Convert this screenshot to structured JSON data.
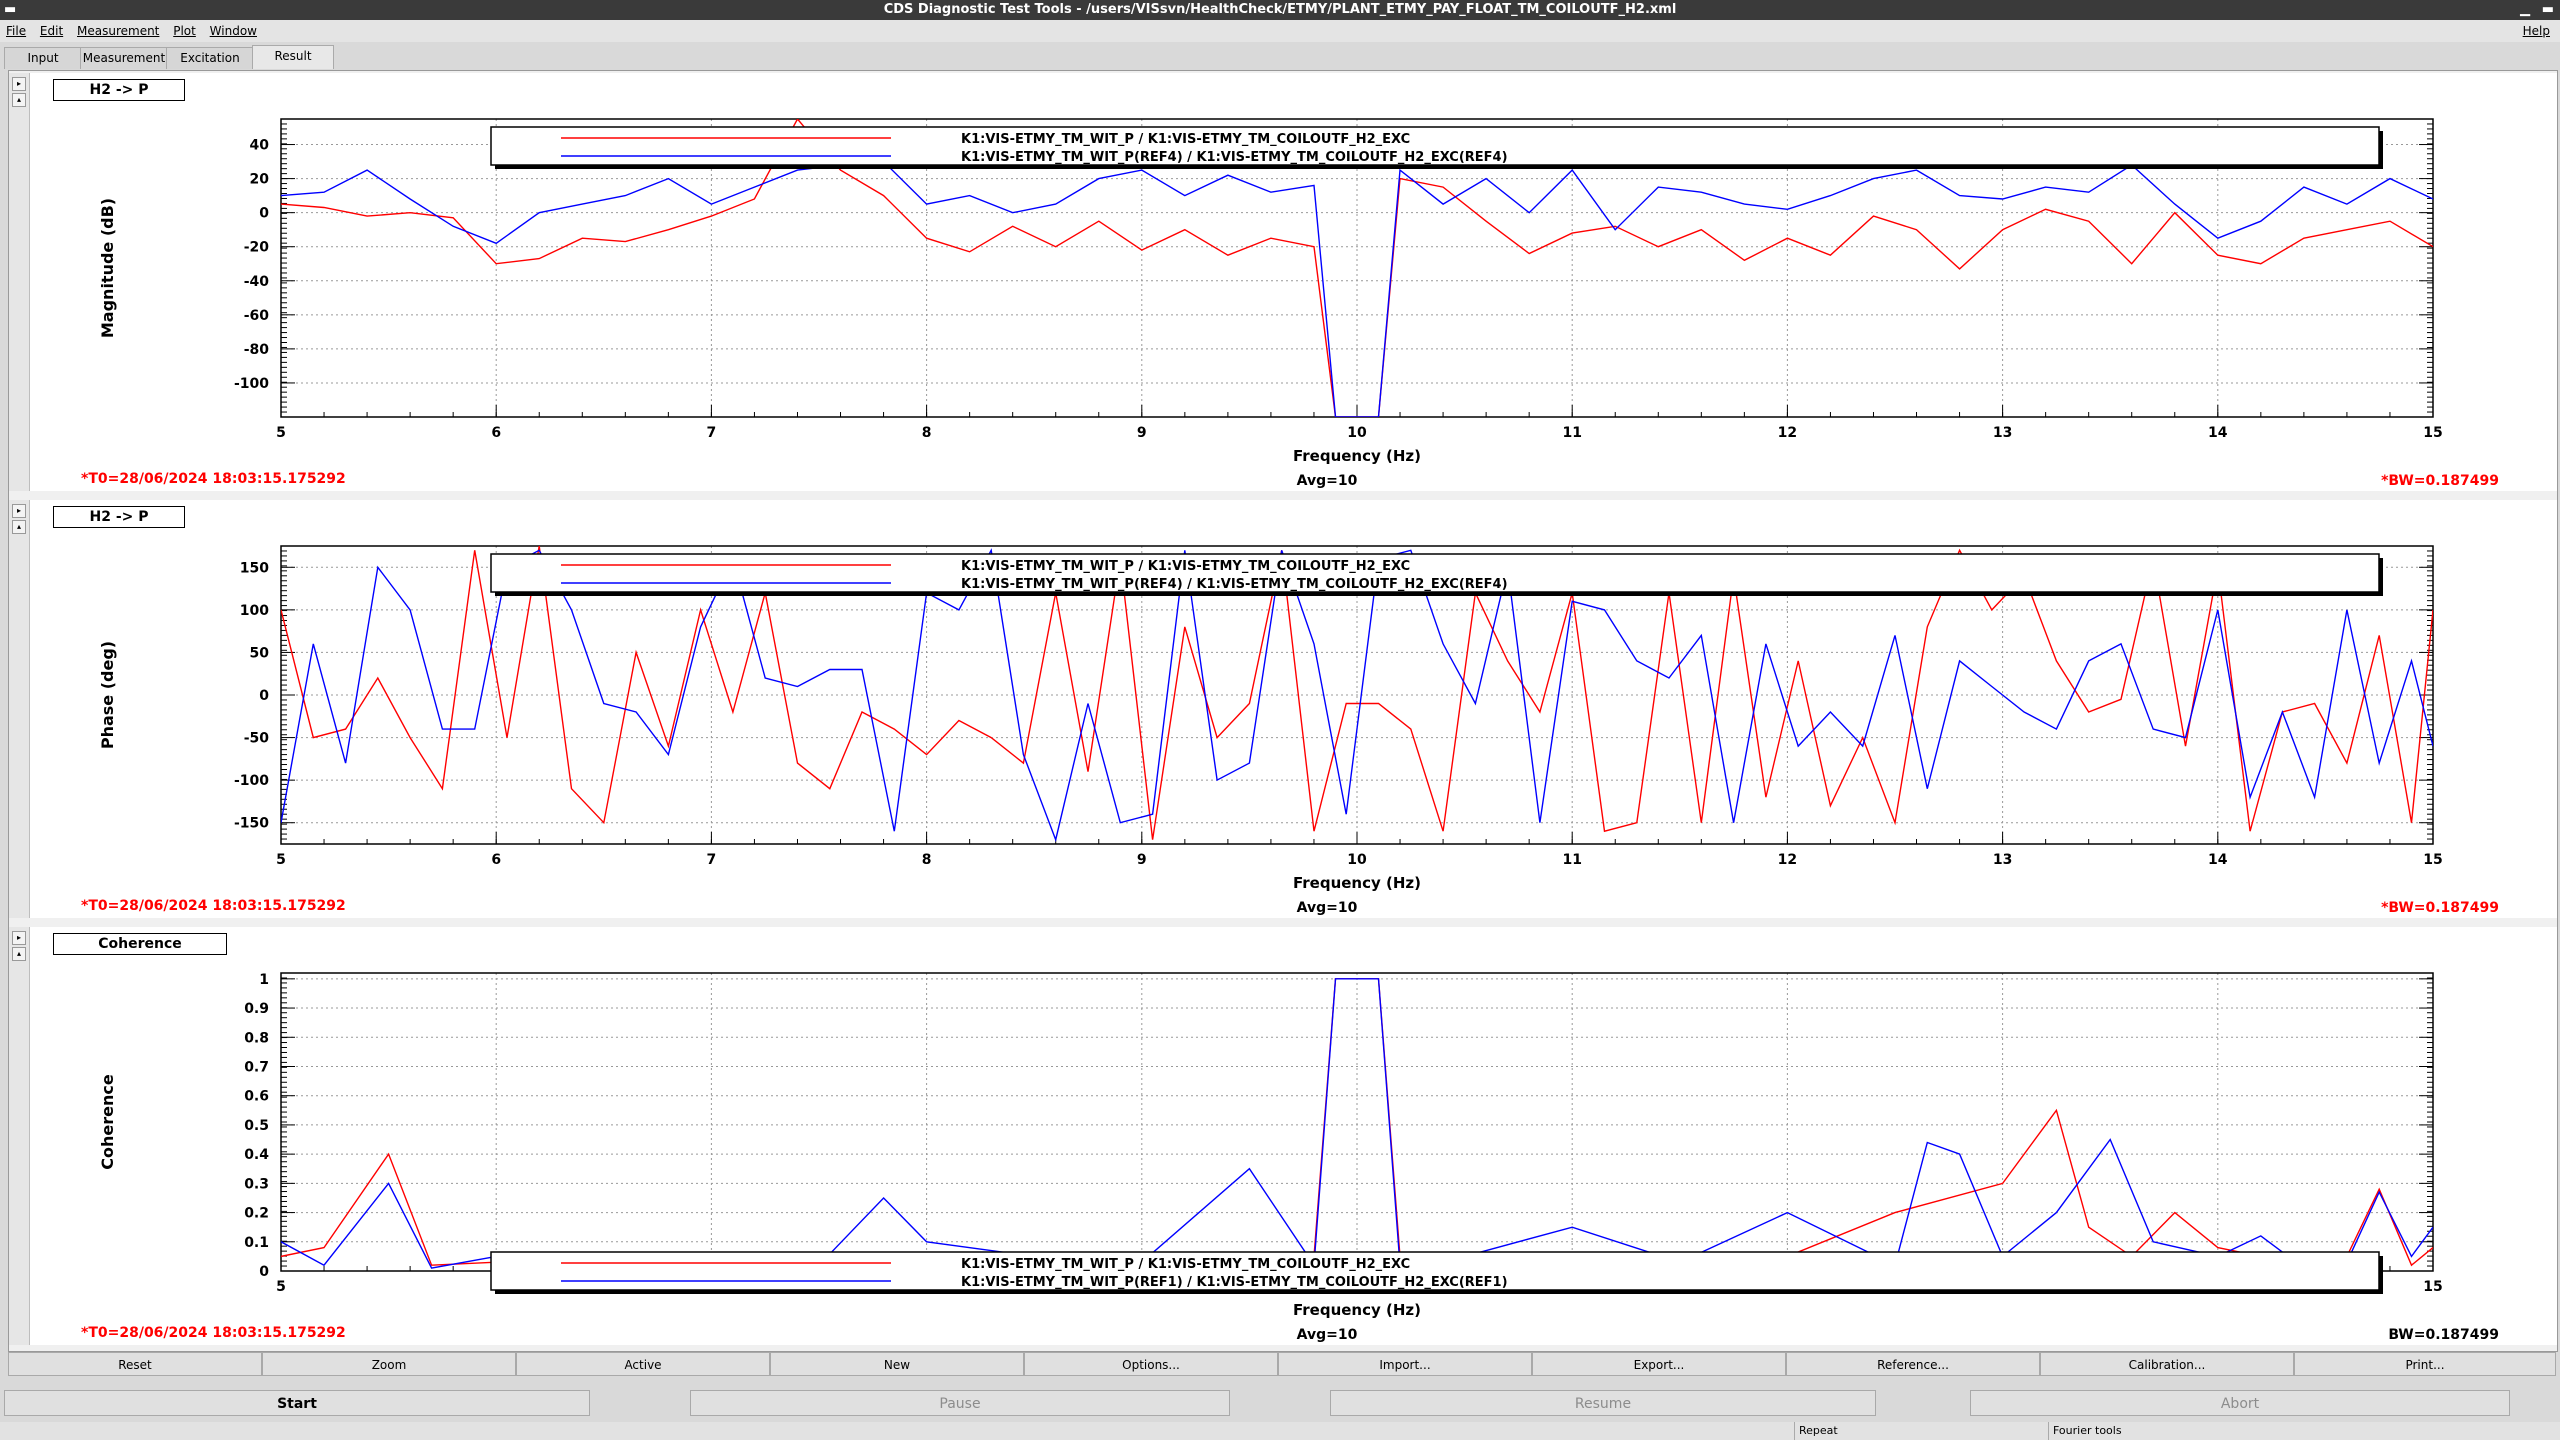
{
  "window": {
    "title": "CDS Diagnostic Test Tools - /users/VISsvn/HealthCheck/ETMY/PLANT_ETMY_PAY_FLOAT_TM_COILOUTF_H2.xml"
  },
  "menu": {
    "items": [
      "File",
      "Edit",
      "Measurement",
      "Plot",
      "Window"
    ],
    "help": "Help"
  },
  "tabs": [
    {
      "label": "Input"
    },
    {
      "label": "Measurement"
    },
    {
      "label": "Excitation"
    },
    {
      "label": "Result"
    }
  ],
  "colors": {
    "trace_a": "#ff0000",
    "trace_b": "#0000ff",
    "info_red": "#ff0000"
  },
  "panels": [
    {
      "title": "H2 -> P",
      "ylabel": "Magnitude (dB)",
      "xlabel": "Frequency (Hz)",
      "t0": "*T0=28/06/2024 18:03:15.175292",
      "avg": "Avg=10",
      "bw": "*BW=0.187499",
      "legend": [
        "K1:VIS-ETMY_TM_WIT_P / K1:VIS-ETMY_TM_COILOUTF_H2_EXC",
        "K1:VIS-ETMY_TM_WIT_P(REF4) / K1:VIS-ETMY_TM_COILOUTF_H2_EXC(REF4)"
      ]
    },
    {
      "title": "H2 -> P",
      "ylabel": "Phase (deg)",
      "xlabel": "Frequency (Hz)",
      "t0": "*T0=28/06/2024 18:03:15.175292",
      "avg": "Avg=10",
      "bw": "*BW=0.187499",
      "legend": [
        "K1:VIS-ETMY_TM_WIT_P / K1:VIS-ETMY_TM_COILOUTF_H2_EXC",
        "K1:VIS-ETMY_TM_WIT_P(REF4) / K1:VIS-ETMY_TM_COILOUTF_H2_EXC(REF4)"
      ]
    },
    {
      "title": "Coherence",
      "ylabel": "Coherence",
      "xlabel": "Frequency (Hz)",
      "t0": "*T0=28/06/2024 18:03:15.175292",
      "avg": "Avg=10",
      "bw": "BW=0.187499",
      "legend": [
        "K1:VIS-ETMY_TM_WIT_P / K1:VIS-ETMY_TM_COILOUTF_H2_EXC",
        "K1:VIS-ETMY_TM_WIT_P(REF1) / K1:VIS-ETMY_TM_COILOUTF_H2_EXC(REF1)"
      ]
    }
  ],
  "chart_data": [
    {
      "type": "line",
      "ylabel": "Magnitude (dB)",
      "xlabel": "Frequency (Hz)",
      "xlim": [
        5,
        15
      ],
      "ylim": [
        -120,
        55
      ],
      "xticks": [
        "5",
        "6",
        "7",
        "8",
        "9",
        "10",
        "11",
        "12",
        "13",
        "14",
        "15"
      ],
      "yticks": [
        -100,
        -80,
        -60,
        -40,
        -20,
        0,
        20,
        40
      ],
      "grid": true,
      "legend": "top-center",
      "series": [
        {
          "name": "K1:VIS-ETMY_TM_WIT_P / K1:VIS-ETMY_TM_COILOUTF_H2_EXC",
          "color": "#ff0000",
          "x": [
            5,
            5.2,
            5.4,
            5.6,
            5.8,
            6,
            6.2,
            6.4,
            6.6,
            6.8,
            7,
            7.2,
            7.4,
            7.6,
            7.8,
            8,
            8.2,
            8.4,
            8.6,
            8.8,
            9,
            9.2,
            9.4,
            9.6,
            9.8,
            9.9,
            10.1,
            10.2,
            10.4,
            10.6,
            10.8,
            11,
            11.2,
            11.4,
            11.6,
            11.8,
            12,
            12.2,
            12.4,
            12.6,
            12.8,
            13,
            13.2,
            13.4,
            13.6,
            13.8,
            14,
            14.2,
            14.4,
            14.6,
            14.8,
            15
          ],
          "y": [
            5,
            3,
            -2,
            0,
            -3,
            -30,
            -27,
            -15,
            -17,
            -10,
            -2,
            8,
            55,
            25,
            10,
            -15,
            -23,
            -8,
            -20,
            -5,
            -22,
            -10,
            -25,
            -15,
            -20,
            -120,
            -120,
            20,
            15,
            -5,
            -24,
            -12,
            -8,
            -20,
            -10,
            -28,
            -15,
            -25,
            -2,
            -10,
            -33,
            -10,
            2,
            -5,
            -30,
            0,
            -25,
            -30,
            -15,
            -10,
            -5,
            -20
          ]
        },
        {
          "name": "K1:VIS-ETMY_TM_WIT_P(REF4) / K1:VIS-ETMY_TM_COILOUTF_H2_EXC(REF4)",
          "color": "#0000ff",
          "x": [
            5,
            5.2,
            5.4,
            5.6,
            5.8,
            6,
            6.2,
            6.4,
            6.6,
            6.8,
            7,
            7.2,
            7.4,
            7.6,
            7.8,
            8,
            8.2,
            8.4,
            8.6,
            8.8,
            9,
            9.2,
            9.4,
            9.6,
            9.8,
            9.9,
            10.1,
            10.2,
            10.4,
            10.6,
            10.8,
            11,
            11.2,
            11.4,
            11.6,
            11.8,
            12,
            12.2,
            12.4,
            12.6,
            12.8,
            13,
            13.2,
            13.4,
            13.6,
            13.8,
            14,
            14.2,
            14.4,
            14.6,
            14.8,
            15
          ],
          "y": [
            10,
            12,
            25,
            8,
            -8,
            -18,
            0,
            5,
            10,
            20,
            5,
            15,
            25,
            28,
            30,
            5,
            10,
            0,
            5,
            20,
            25,
            10,
            22,
            12,
            16,
            -120,
            -120,
            25,
            5,
            20,
            0,
            25,
            -10,
            15,
            12,
            5,
            2,
            10,
            20,
            25,
            10,
            8,
            15,
            12,
            28,
            5,
            -15,
            -5,
            15,
            5,
            20,
            8
          ]
        }
      ]
    },
    {
      "type": "line",
      "ylabel": "Phase (deg)",
      "xlabel": "Frequency (Hz)",
      "xlim": [
        5,
        15
      ],
      "ylim": [
        -175,
        175
      ],
      "xticks": [
        "5",
        "6",
        "7",
        "8",
        "9",
        "10",
        "11",
        "12",
        "13",
        "14",
        "15"
      ],
      "yticks": [
        -150,
        -100,
        -50,
        0,
        50,
        100,
        150
      ],
      "grid": true,
      "legend": "top-center",
      "series": [
        {
          "name": "K1:VIS-ETMY_TM_WIT_P / K1:VIS-ETMY_TM_COILOUTF_H2_EXC",
          "color": "#ff0000",
          "x": [
            5,
            5.15,
            5.3,
            5.45,
            5.6,
            5.75,
            5.9,
            6.05,
            6.2,
            6.35,
            6.5,
            6.65,
            6.8,
            6.95,
            7.1,
            7.25,
            7.4,
            7.55,
            7.7,
            7.85,
            8,
            8.15,
            8.3,
            8.45,
            8.6,
            8.75,
            8.9,
            9.05,
            9.2,
            9.35,
            9.5,
            9.65,
            9.8,
            9.95,
            10.1,
            10.25,
            10.4,
            10.55,
            10.7,
            10.85,
            11,
            11.15,
            11.3,
            11.45,
            11.6,
            11.75,
            11.9,
            12.05,
            12.2,
            12.35,
            12.5,
            12.65,
            12.8,
            12.95,
            13.1,
            13.25,
            13.4,
            13.55,
            13.7,
            13.85,
            14,
            14.15,
            14.3,
            14.45,
            14.6,
            14.75,
            14.9,
            15
          ],
          "y": [
            100,
            -50,
            -40,
            20,
            -50,
            -110,
            170,
            -50,
            175,
            -110,
            -150,
            50,
            -60,
            100,
            -20,
            120,
            -80,
            -110,
            -20,
            -40,
            -70,
            -30,
            -50,
            -80,
            120,
            -90,
            160,
            -170,
            80,
            -50,
            -10,
            170,
            -160,
            -10,
            -10,
            -40,
            -160,
            120,
            40,
            -20,
            120,
            -160,
            -150,
            120,
            -150,
            140,
            -120,
            40,
            -130,
            -50,
            -150,
            80,
            170,
            100,
            140,
            40,
            -20,
            -5,
            160,
            -60,
            150,
            -160,
            -20,
            -10,
            -80,
            70,
            -150,
            100
          ]
        },
        {
          "name": "K1:VIS-ETMY_TM_WIT_P(REF4) / K1:VIS-ETMY_TM_COILOUTF_H2_EXC(REF4)",
          "color": "#0000ff",
          "x": [
            5,
            5.15,
            5.3,
            5.45,
            5.6,
            5.75,
            5.9,
            6.05,
            6.2,
            6.35,
            6.5,
            6.65,
            6.8,
            6.95,
            7.1,
            7.25,
            7.4,
            7.55,
            7.7,
            7.85,
            8,
            8.15,
            8.3,
            8.45,
            8.6,
            8.75,
            8.9,
            9.05,
            9.2,
            9.35,
            9.5,
            9.65,
            9.8,
            9.95,
            10.1,
            10.25,
            10.4,
            10.55,
            10.7,
            10.85,
            11,
            11.15,
            11.3,
            11.45,
            11.6,
            11.75,
            11.9,
            12.05,
            12.2,
            12.35,
            12.5,
            12.65,
            12.8,
            12.95,
            13.1,
            13.25,
            13.4,
            13.55,
            13.7,
            13.85,
            14,
            14.15,
            14.3,
            14.45,
            14.6,
            14.75,
            14.9,
            15
          ],
          "y": [
            -150,
            60,
            -80,
            150,
            100,
            -40,
            -40,
            150,
            170,
            100,
            -10,
            -20,
            -70,
            80,
            160,
            20,
            10,
            30,
            30,
            -160,
            120,
            100,
            170,
            -70,
            -170,
            -10,
            -150,
            -140,
            170,
            -100,
            -80,
            170,
            60,
            -140,
            160,
            170,
            60,
            -10,
            150,
            -150,
            110,
            100,
            40,
            20,
            70,
            -150,
            60,
            -60,
            -20,
            -60,
            70,
            -110,
            40,
            10,
            -20,
            -40,
            40,
            60,
            -40,
            -50,
            100,
            -120,
            -20,
            -120,
            100,
            -80,
            40,
            -60
          ]
        }
      ]
    },
    {
      "type": "line",
      "ylabel": "Coherence",
      "xlabel": "Frequency (Hz)",
      "xlim": [
        5,
        15
      ],
      "ylim": [
        0,
        1.02
      ],
      "xticks": [
        "5",
        "6",
        "7",
        "8",
        "9",
        "10",
        "11",
        "12",
        "13",
        "14",
        "15"
      ],
      "yticks": [
        "0",
        "0.1",
        "0.2",
        "0.3",
        "0.4",
        "0.5",
        "0.6",
        "0.7",
        "0.8",
        "0.9",
        "1"
      ],
      "grid": true,
      "legend": "bottom-center",
      "series": [
        {
          "name": "K1:VIS-ETMY_TM_WIT_P / K1:VIS-ETMY_TM_COILOUTF_H2_EXC",
          "color": "#ff0000",
          "x": [
            5,
            5.2,
            5.5,
            5.7,
            6,
            6.5,
            7,
            7.5,
            8,
            8.5,
            9,
            9.5,
            9.8,
            9.9,
            10.1,
            10.2,
            10.5,
            11,
            11.5,
            12,
            12.5,
            13,
            13.25,
            13.4,
            13.6,
            13.8,
            14,
            14.2,
            14.4,
            14.6,
            14.75,
            14.9,
            15
          ],
          "y": [
            0.05,
            0.08,
            0.4,
            0.02,
            0.03,
            0.02,
            0.01,
            0.03,
            0.02,
            0.04,
            0.01,
            0.03,
            0.05,
            1.0,
            1.0,
            0.05,
            0.03,
            0.02,
            0.03,
            0.05,
            0.2,
            0.3,
            0.55,
            0.15,
            0.05,
            0.2,
            0.08,
            0.05,
            0.02,
            0.05,
            0.28,
            0.02,
            0.08
          ]
        },
        {
          "name": "K1:VIS-ETMY_TM_WIT_P(REF1) / K1:VIS-ETMY_TM_COILOUTF_H2_EXC(REF1)",
          "color": "#0000ff",
          "x": [
            5,
            5.2,
            5.5,
            5.7,
            6,
            6.5,
            7,
            7.5,
            7.8,
            8,
            8.5,
            9,
            9.5,
            9.8,
            9.9,
            10.1,
            10.2,
            10.5,
            11,
            11.5,
            12,
            12.5,
            12.65,
            12.8,
            13,
            13.25,
            13.5,
            13.7,
            14,
            14.2,
            14.4,
            14.6,
            14.75,
            14.9,
            15
          ],
          "y": [
            0.1,
            0.02,
            0.3,
            0.01,
            0.05,
            0.02,
            0.04,
            0.02,
            0.25,
            0.1,
            0.05,
            0.03,
            0.35,
            0.02,
            1.0,
            1.0,
            0.02,
            0.05,
            0.15,
            0.03,
            0.2,
            0.02,
            0.44,
            0.4,
            0.05,
            0.2,
            0.45,
            0.1,
            0.05,
            0.12,
            0.01,
            0.03,
            0.27,
            0.05,
            0.15
          ]
        }
      ]
    }
  ],
  "buttons": [
    "Reset",
    "Zoom",
    "Active",
    "New",
    "Options...",
    "Import...",
    "Export...",
    "Reference...",
    "Calibration...",
    "Print..."
  ],
  "actions": [
    "Start",
    "Pause",
    "Resume",
    "Abort"
  ],
  "status": [
    "Repeat",
    "Fourier tools"
  ]
}
